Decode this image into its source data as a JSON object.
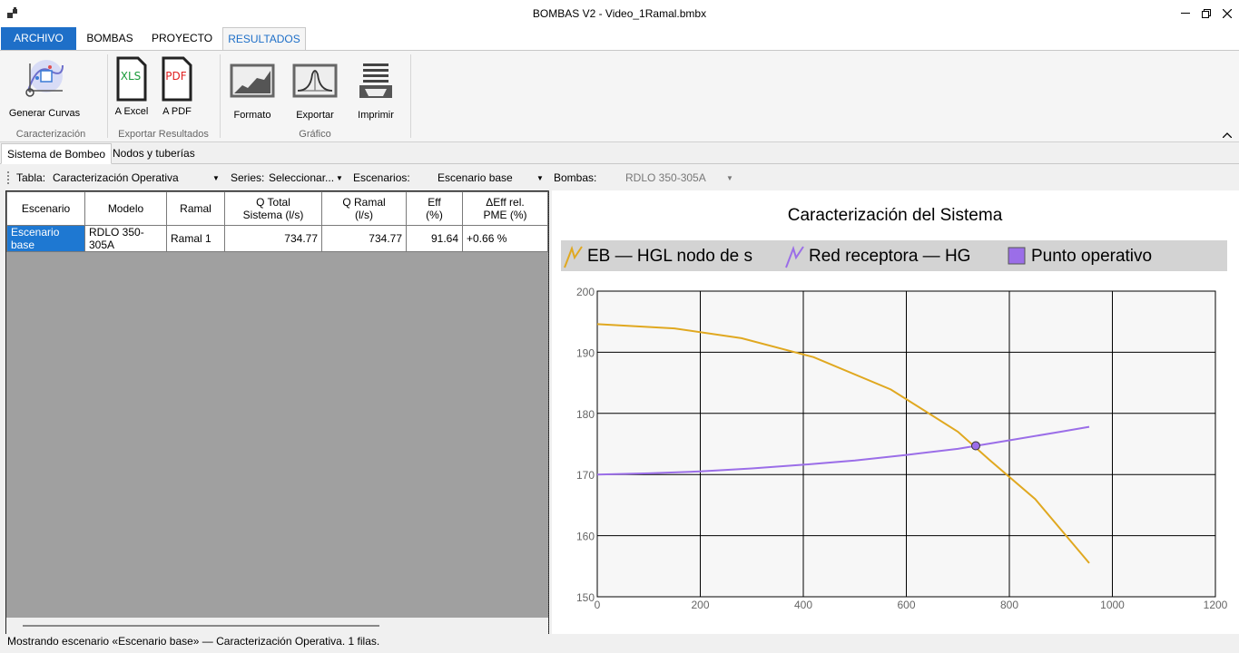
{
  "window": {
    "title": "BOMBAS V2 - Video_1Ramal.bmbx"
  },
  "ribbon_tabs": [
    "ARCHIVO",
    "BOMBAS",
    "PROYECTO",
    "RESULTADOS"
  ],
  "ribbon": {
    "groups": {
      "caracterizacion": "Caracterización",
      "exportar": "Exportar Resultados",
      "grafico": "Gráfico"
    },
    "buttons": {
      "generar": "Generar Curvas",
      "excel": "A Excel",
      "pdf": "A PDF",
      "formato": "Formato",
      "exportar": "Exportar",
      "imprimir": "Imprimir"
    },
    "icons": {
      "excel": "XLS",
      "pdf": "PDF"
    }
  },
  "sub_tabs": [
    "Sistema de Bombeo",
    "Nodos y tuberías"
  ],
  "toolbar": {
    "tabla_label": "Tabla:",
    "tabla_value": "Caracterización Operativa",
    "series_label": "Series:",
    "series_value": "Seleccionar...",
    "escenarios_label": "Escenarios:",
    "escenarios_value": "Escenario base",
    "bombas_label": "Bombas:",
    "bombas_value": "RDLO 350-305A"
  },
  "table": {
    "headers": [
      "Escenario",
      "Modelo",
      "Ramal",
      "Q Total\nSistema (l/s)",
      "Q Ramal\n(l/s)",
      "Eff\n(%)",
      "ΔEff rel.\nPME (%)"
    ],
    "rows": [
      [
        "Escenario base",
        "RDLO 350-305A",
        "Ramal 1",
        "734.77",
        "734.77",
        "91.64",
        "+0.66 %"
      ]
    ]
  },
  "status": "Mostrando escenario «Escenario base» — Caracterización Operativa. 1 filas.",
  "chart_data": {
    "type": "line",
    "title": "Caracterización del Sistema",
    "legend": [
      "EB — HGL nodo de s",
      "Red receptora — HG",
      "Punto operativo"
    ],
    "legend_placement": "top",
    "xlim": [
      0,
      1200
    ],
    "ylim": [
      150,
      200
    ],
    "xticks": [
      0,
      200,
      400,
      600,
      800,
      1000,
      1200
    ],
    "yticks": [
      150,
      160,
      170,
      180,
      190,
      200
    ],
    "grid": true,
    "series": [
      {
        "name": "EB — HGL nodo de s",
        "color": "#e0a820",
        "x": [
          0,
          150,
          280,
          420,
          570,
          700,
          760,
          850,
          955
        ],
        "y": [
          194.6,
          193.9,
          192.3,
          189.2,
          183.9,
          177.0,
          172.5,
          166.0,
          155.5
        ]
      },
      {
        "name": "Red receptora — HG",
        "color": "#9b6ee8",
        "x": [
          0,
          100,
          200,
          300,
          400,
          500,
          600,
          700,
          800,
          900,
          955
        ],
        "y": [
          170.0,
          170.2,
          170.5,
          171.0,
          171.6,
          172.3,
          173.2,
          174.2,
          175.6,
          177.0,
          177.8
        ]
      },
      {
        "name": "Punto operativo",
        "type": "scatter",
        "color": "#9b6ee8",
        "x": [
          734.77
        ],
        "y": [
          174.7
        ]
      }
    ]
  }
}
